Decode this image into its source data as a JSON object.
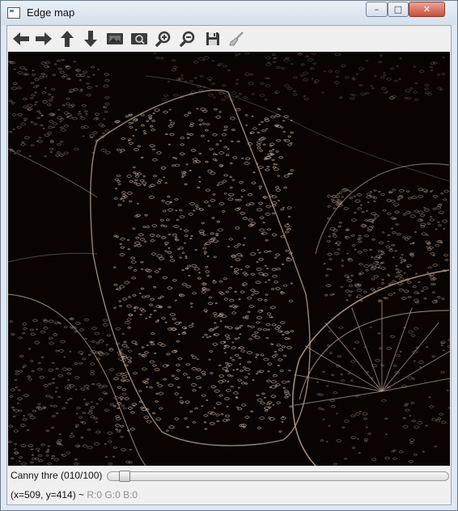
{
  "window": {
    "title": "Edge map",
    "controls": {
      "minimize": "–",
      "maximize": "□",
      "close": "✕"
    }
  },
  "toolbar": {
    "buttons": [
      {
        "name": "pan-left-button",
        "icon": "arrow-left-icon"
      },
      {
        "name": "pan-right-button",
        "icon": "arrow-right-icon"
      },
      {
        "name": "pan-up-button",
        "icon": "arrow-up-icon"
      },
      {
        "name": "pan-down-button",
        "icon": "arrow-down-icon"
      },
      {
        "name": "zoom-fit-button",
        "icon": "image-icon"
      },
      {
        "name": "zoom-original-button",
        "icon": "image-zoom-icon"
      },
      {
        "name": "zoom-in-button",
        "icon": "zoom-in-icon"
      },
      {
        "name": "zoom-out-button",
        "icon": "zoom-out-icon"
      },
      {
        "name": "save-button",
        "icon": "floppy-disk-icon"
      },
      {
        "name": "properties-button",
        "icon": "brush-icon"
      }
    ],
    "icon_color": "#3b3b3b"
  },
  "image": {
    "description_icon": "edge-map-image",
    "background": "#090302",
    "edge_color": "#bca593"
  },
  "trackbar": {
    "label": "Canny thre (010/100)",
    "value": 10,
    "max": 100
  },
  "status": {
    "coords": "(x=509, y=414) ~",
    "rgb": "R:0 G:0 B:0"
  }
}
